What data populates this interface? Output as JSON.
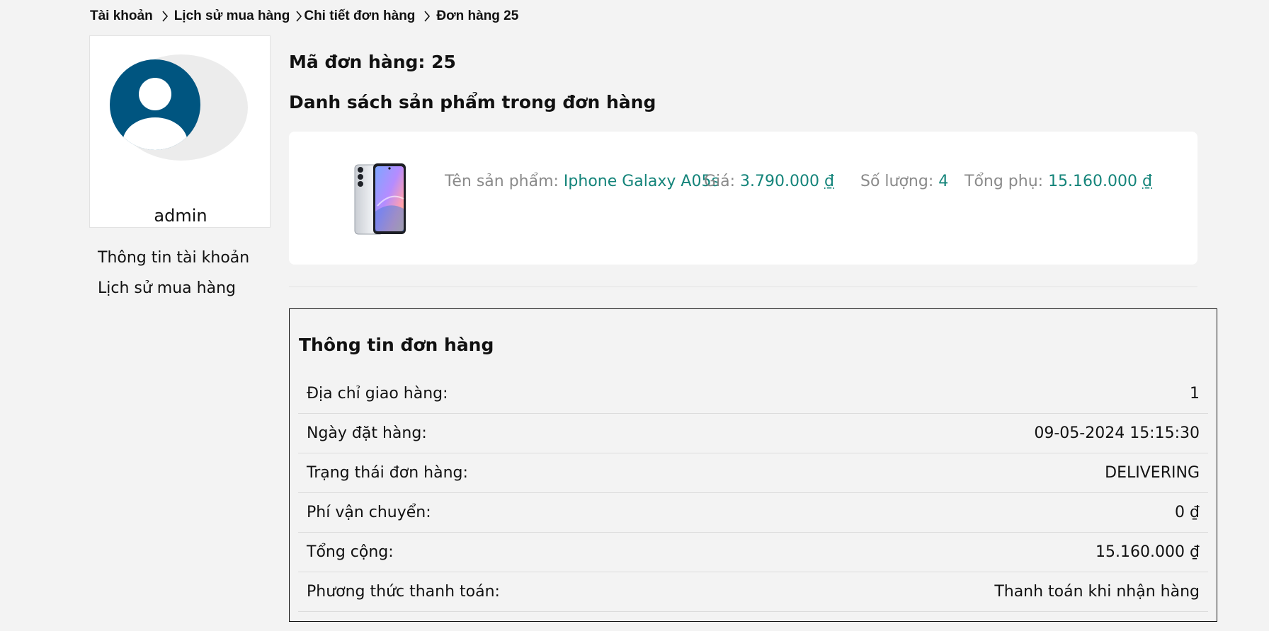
{
  "breadcrumb": {
    "items": [
      "Tài khoản",
      "Lịch sử mua hàng",
      "Chi tiết đơn hàng",
      "Đơn hàng 25"
    ]
  },
  "profile": {
    "username": "admin",
    "avatar_icon": "user-avatar-icon",
    "avatar_color": "#005580"
  },
  "sidebar": {
    "items": [
      {
        "label": "Thông tin tài khoản"
      },
      {
        "label": "Lịch sử mua hàng"
      }
    ]
  },
  "order": {
    "id_text": "Mã đơn hàng: 25",
    "products_heading": "Danh sách sản phẩm trong đơn hàng",
    "products": [
      {
        "name_label": "Tên sản phẩm: ",
        "name": "Iphone Galaxy A05s",
        "price_label": "Giá: ",
        "price": "3.790.000",
        "quantity_label": "Số lượng: ",
        "quantity": "4",
        "subtotal_label": "Tổng phụ: ",
        "subtotal": "15.160.000"
      }
    ],
    "currency": "₫",
    "value_color": "#14847a"
  },
  "order_info": {
    "title": "Thông tin đơn hàng",
    "rows": [
      {
        "label": "Địa chỉ giao hàng:",
        "value": "1"
      },
      {
        "label": "Ngày đặt hàng:",
        "value": "09-05-2024 15:15:30"
      },
      {
        "label": "Trạng thái đơn hàng:",
        "value": "DELIVERING"
      },
      {
        "label": "Phí vận chuyển:",
        "value": "0 ₫"
      },
      {
        "label": "Tổng cộng:",
        "value": "15.160.000 ₫"
      },
      {
        "label": "Phương thức thanh toán:",
        "value": "Thanh toán khi nhận hàng"
      }
    ]
  }
}
